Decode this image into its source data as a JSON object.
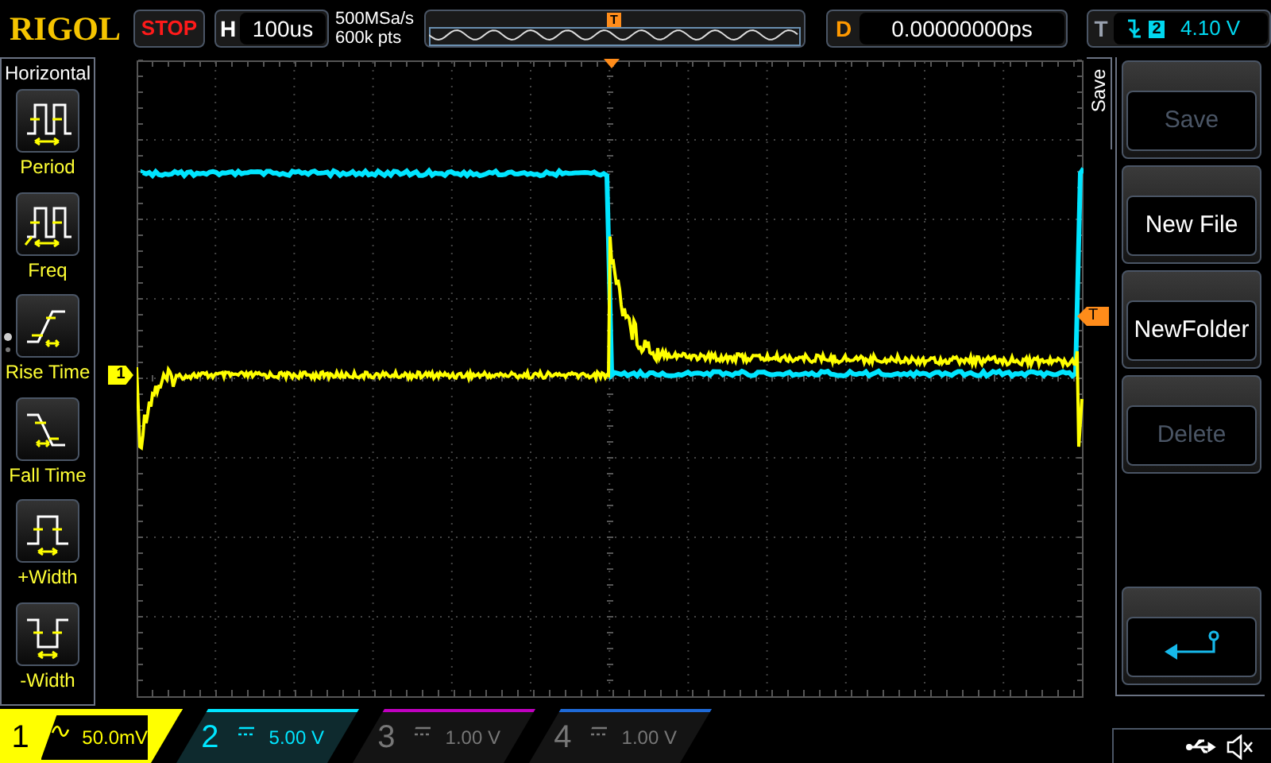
{
  "header": {
    "logo": "RIGOL",
    "run_state": "STOP",
    "horizontal": {
      "label": "H",
      "value": "100us"
    },
    "sample_rate": "500MSa/s",
    "memory_depth": "600k pts",
    "overview_trigger": "T",
    "delay": {
      "label": "D",
      "value": "0.00000000ps"
    },
    "trigger": {
      "label": "T",
      "source": "2",
      "level": "4.10 V"
    }
  },
  "left_menu": {
    "title": "Horizontal",
    "items": [
      {
        "label": "Period",
        "kind": "period"
      },
      {
        "label": "Freq",
        "kind": "freq"
      },
      {
        "label": "Rise Time",
        "kind": "rise"
      },
      {
        "label": "Fall Time",
        "kind": "fall"
      },
      {
        "label": "+Width",
        "kind": "pwidth"
      },
      {
        "label": "-Width",
        "kind": "nwidth"
      }
    ]
  },
  "plot": {
    "channel_marker": "1",
    "trigger_level_marker": "T"
  },
  "right_menu": {
    "tab": "Save",
    "buttons": [
      {
        "kind": "text",
        "label": "Save",
        "disabled": true
      },
      {
        "kind": "text",
        "label": "New File",
        "disabled": false
      },
      {
        "kind": "text",
        "label": "NewFolder",
        "disabled": false
      },
      {
        "kind": "text",
        "label": "Delete",
        "disabled": true
      },
      {
        "kind": "back"
      }
    ]
  },
  "channels": [
    {
      "number": "1",
      "kind": "ac",
      "scale": "50.0mV",
      "on": true,
      "selected": true,
      "color": "#ffff00"
    },
    {
      "number": "2",
      "kind": "dc",
      "scale": "5.00 V",
      "on": true,
      "selected": false,
      "color": "#00e5ff"
    },
    {
      "number": "3",
      "kind": "dc",
      "scale": "1.00 V",
      "on": false,
      "selected": false,
      "color": "#c000c0"
    },
    {
      "number": "4",
      "kind": "dc",
      "scale": "1.00 V",
      "on": false,
      "selected": false,
      "color": "#1e6ad8"
    }
  ]
}
